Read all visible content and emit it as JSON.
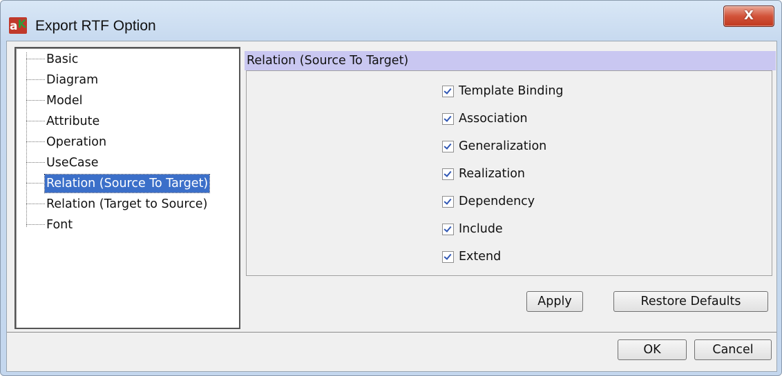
{
  "window": {
    "title": "Export RTF Option",
    "close_label": "X"
  },
  "tree": {
    "items": [
      {
        "label": "Basic",
        "selected": false
      },
      {
        "label": "Diagram",
        "selected": false
      },
      {
        "label": "Model",
        "selected": false
      },
      {
        "label": "Attribute",
        "selected": false
      },
      {
        "label": "Operation",
        "selected": false
      },
      {
        "label": "UseCase",
        "selected": false
      },
      {
        "label": "Relation (Source To Target)",
        "selected": true
      },
      {
        "label": "Relation (Target to Source)",
        "selected": false
      },
      {
        "label": "Font",
        "selected": false
      }
    ]
  },
  "panel": {
    "header": "Relation (Source To Target)",
    "options": [
      {
        "label": "Template Binding",
        "checked": true
      },
      {
        "label": "Association",
        "checked": true
      },
      {
        "label": "Generalization",
        "checked": true
      },
      {
        "label": "Realization",
        "checked": true
      },
      {
        "label": "Dependency",
        "checked": true
      },
      {
        "label": "Include",
        "checked": true
      },
      {
        "label": "Extend",
        "checked": true
      }
    ],
    "apply_label": "Apply",
    "restore_label": "Restore Defaults"
  },
  "footer": {
    "ok_label": "OK",
    "cancel_label": "Cancel"
  },
  "colors": {
    "selection": "#3b6fc9",
    "section_header": "#c9c7f1",
    "close_button": "#c0391f",
    "checkmark": "#2f56b3"
  }
}
